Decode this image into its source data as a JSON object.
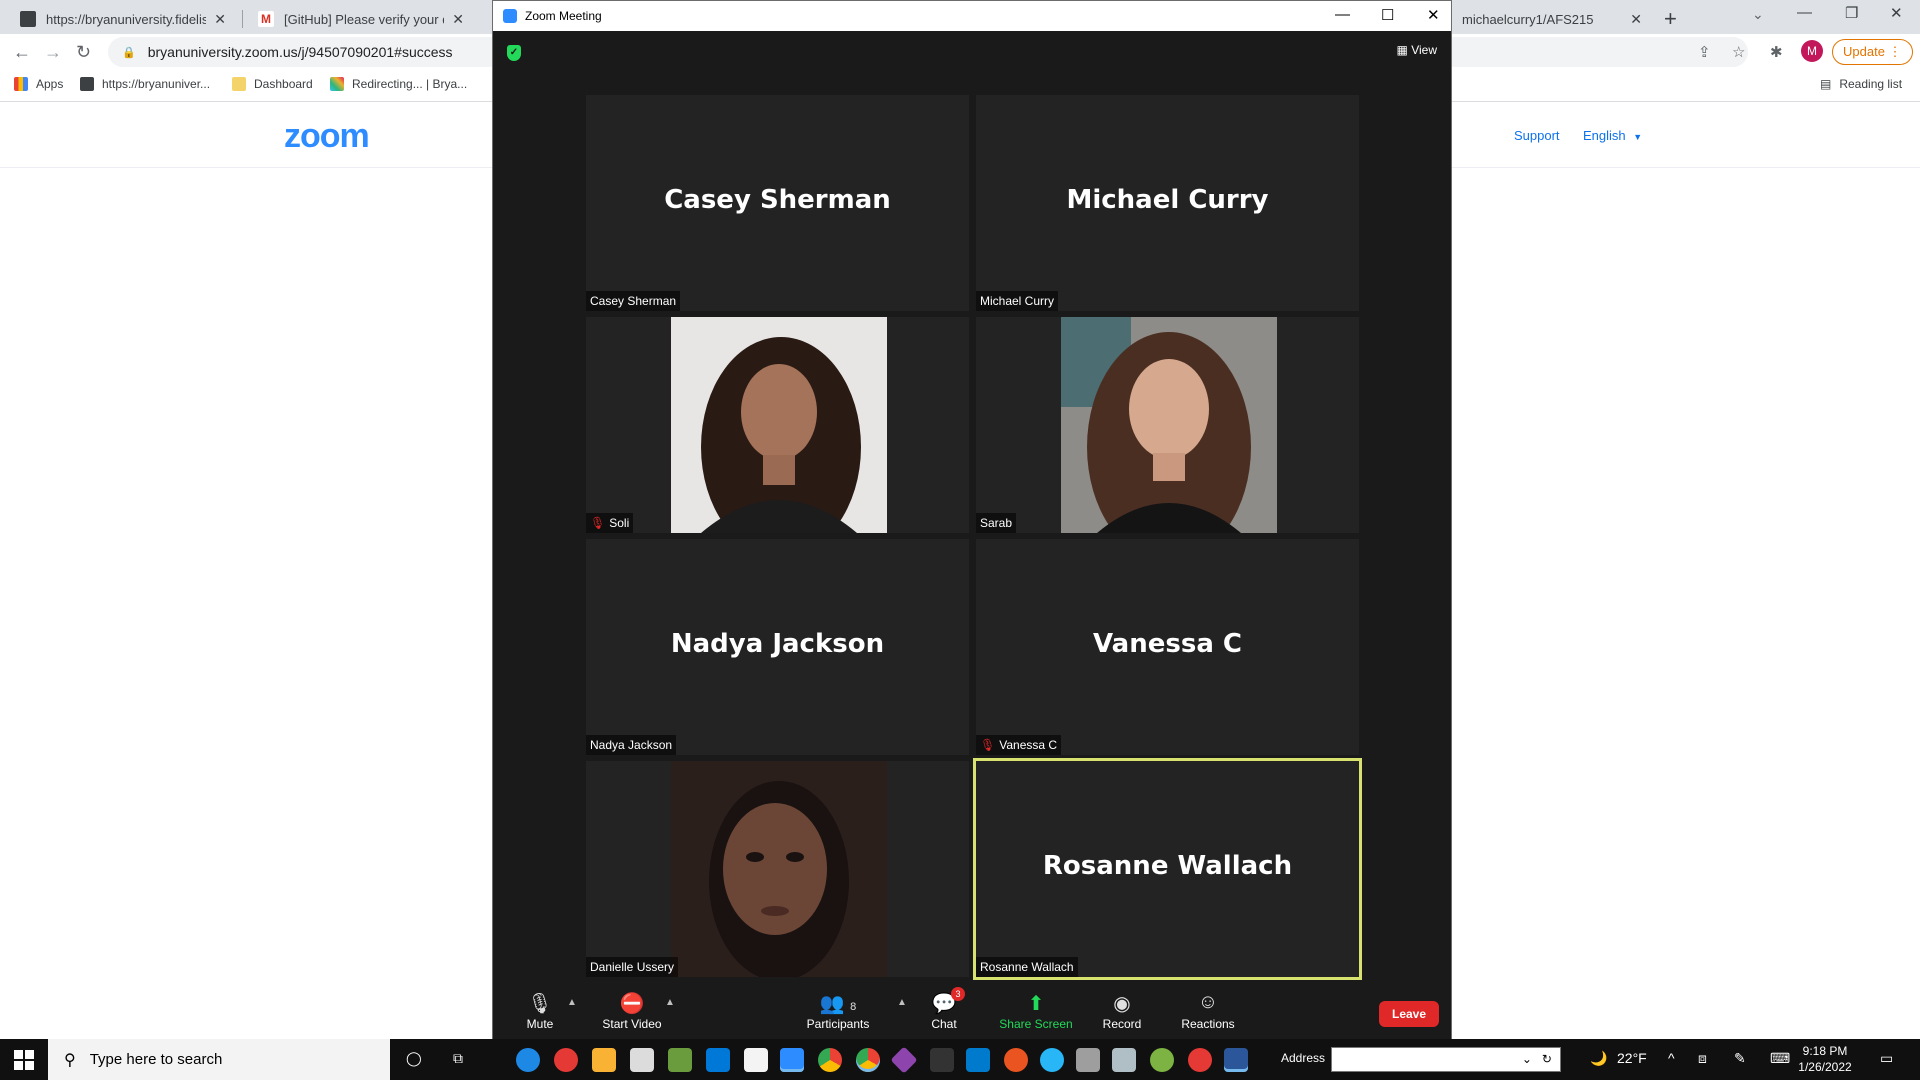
{
  "browser": {
    "tabs": [
      {
        "title": "https://bryanuniversity.fidelisedu"
      },
      {
        "title": "[GitHub] Please verify your device"
      },
      {
        "title": "michaelcurry1/AFS215"
      }
    ],
    "url": "bryanuniversity.zoom.us/j/94507090201#success",
    "update_label": "Update",
    "profile_initial": "M",
    "bookmarks": [
      {
        "label": "Apps"
      },
      {
        "label": "https://bryanuniver..."
      },
      {
        "label": "Dashboard"
      },
      {
        "label": "Redirecting... | Brya..."
      }
    ],
    "reading_list": "Reading list"
  },
  "page": {
    "logo": "zoom",
    "support": "Support",
    "language": "English"
  },
  "zoom": {
    "window_title": "Zoom Meeting",
    "view_label": "View",
    "participants": [
      {
        "name": "Casey Sherman",
        "label": "Casey Sherman",
        "muted": false,
        "video": false
      },
      {
        "name": "Michael Curry",
        "label": "Michael Curry",
        "muted": false,
        "video": false
      },
      {
        "name": "Soli",
        "label": "Soli",
        "muted": true,
        "video": true
      },
      {
        "name": "Sarab",
        "label": "Sarab",
        "muted": false,
        "video": true
      },
      {
        "name": "Nadya Jackson",
        "label": "Nadya Jackson",
        "muted": false,
        "video": false
      },
      {
        "name": "Vanessa C",
        "label": "Vanessa C",
        "muted": true,
        "video": false
      },
      {
        "name": "Danielle Ussery",
        "label": "Danielle Ussery",
        "muted": false,
        "video": true
      },
      {
        "name": "Rosanne Wallach",
        "label": "Rosanne Wallach",
        "muted": false,
        "video": false,
        "active_speaker": true
      }
    ],
    "toolbar": {
      "mute": "Mute",
      "start_video": "Start Video",
      "participants": "Participants",
      "participants_count": "8",
      "chat": "Chat",
      "chat_badge": "3",
      "share_screen": "Share Screen",
      "record": "Record",
      "reactions": "Reactions",
      "leave": "Leave"
    },
    "colors": {
      "share_green": "#23d959",
      "leave_red": "#e02828",
      "speaker_border": "#d7e36e"
    }
  },
  "taskbar": {
    "search_placeholder": "Type here to search",
    "address_label": "Address",
    "weather": "22°F",
    "time": "9:18 PM",
    "date": "1/26/2022"
  }
}
